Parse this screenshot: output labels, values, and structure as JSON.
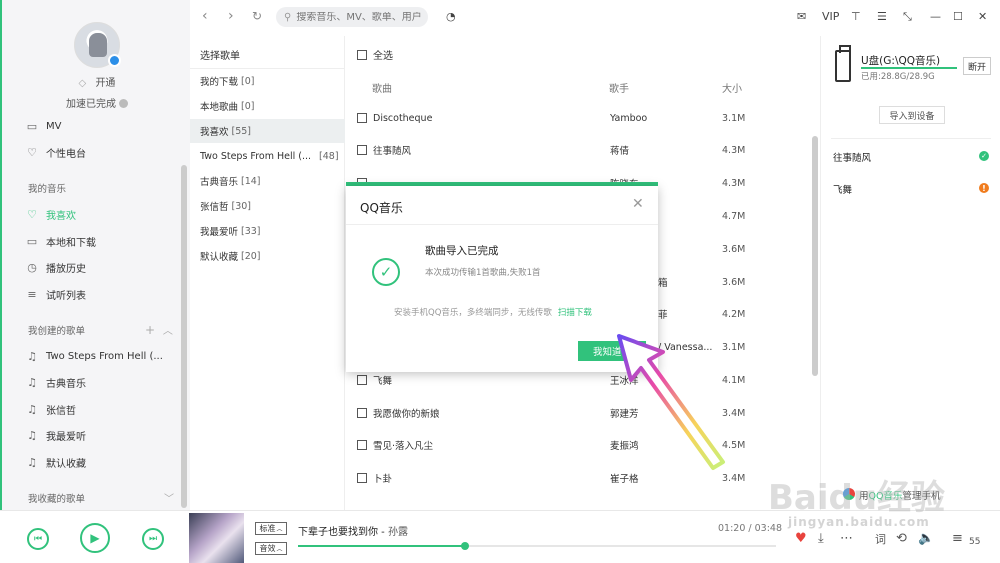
{
  "user": {
    "open_label": "开通",
    "accel_label": "加速已完成"
  },
  "sidebar": {
    "top_items": [
      {
        "label": "MV",
        "icon": "tv-icon"
      },
      {
        "label": "个性电台",
        "icon": "radio-heart-icon"
      }
    ],
    "my_music_title": "我的音乐",
    "my_music": [
      {
        "label": "我喜欢",
        "icon": "heart-icon",
        "active": true
      },
      {
        "label": "本地和下载",
        "icon": "monitor-icon"
      },
      {
        "label": "播放历史",
        "icon": "clock-icon"
      },
      {
        "label": "试听列表",
        "icon": "list-icon"
      }
    ],
    "created_title": "我创建的歌单",
    "created": [
      {
        "label": "Two Steps From Hell (..."
      },
      {
        "label": "古典音乐"
      },
      {
        "label": "张信哲"
      },
      {
        "label": "我最爱听"
      },
      {
        "label": "默认收藏"
      }
    ],
    "collected_title": "我收藏的歌单"
  },
  "topbar": {
    "search_placeholder": "搜索音乐、MV、歌单、用户",
    "vip_label": "VIP"
  },
  "playlists": {
    "title": "选择歌单",
    "items": [
      {
        "name": "我的下载",
        "count": "[0]"
      },
      {
        "name": "本地歌曲",
        "count": "[0]"
      },
      {
        "name": "我喜欢",
        "count": "[55]",
        "selected": true
      },
      {
        "name": "Two Steps From Hell (...",
        "count": "[48]"
      },
      {
        "name": "古典音乐",
        "count": "[14]"
      },
      {
        "name": "张信哲",
        "count": "[30]"
      },
      {
        "name": "我最爱听",
        "count": "[33]"
      },
      {
        "name": "默认收藏",
        "count": "[20]"
      }
    ]
  },
  "songs": {
    "select_all": "全选",
    "col_song": "歌曲",
    "col_artist": "歌手",
    "col_size": "大小",
    "rows": [
      {
        "name": "Discotheque",
        "artist": "Yamboo",
        "size": "3.1M"
      },
      {
        "name": "往事随风",
        "artist": "蒋倩",
        "size": "4.3M"
      },
      {
        "name": "",
        "artist": "",
        "size": "4.3M"
      },
      {
        "name": "",
        "artist": "",
        "size": "4.7M"
      },
      {
        "name": "",
        "artist": "",
        "size": "3.6M"
      },
      {
        "name": "",
        "artist": "",
        "size": "3.6M"
      },
      {
        "name": "",
        "artist": "",
        "size": "4.2M"
      },
      {
        "name": "",
        "artist": "",
        "size": "3.1M"
      },
      {
        "name": "飞舞",
        "artist": "王冰洋",
        "size": "4.1M"
      },
      {
        "name": "我愿做你的新娘",
        "artist": "郭建芳",
        "size": "3.4M"
      },
      {
        "name": "雪见·落入凡尘",
        "artist": "麦振鸿",
        "size": "4.5M"
      },
      {
        "name": "卜卦",
        "artist": "崔子格",
        "size": "3.4M"
      }
    ],
    "partial_artists": [
      "陈晓东",
      "箱",
      "菲",
      "/ Vanessa..."
    ]
  },
  "device": {
    "name": "U盘(G:\\QQ音乐)",
    "used": "已用:28.8G/28.9G",
    "used_fraction": 0.997,
    "disconnect_label": "断开",
    "import_label": "导入到设备",
    "songs": [
      {
        "name": "往事随风",
        "status": "ok"
      },
      {
        "name": "飞舞",
        "status": "warning"
      }
    ],
    "bottom_pre": "用",
    "bottom_link": "QQ音乐",
    "bottom_post": "管理手机"
  },
  "dialog": {
    "title": "QQ音乐",
    "headline": "歌曲导入已完成",
    "sub": "本次成功传输1首歌曲,失败1首",
    "promo": "安装手机QQ音乐，多终端同步，无线传歌",
    "promo_link": "扫描下载",
    "ok_label": "我知道了"
  },
  "player": {
    "quality_label": "标准",
    "effect_label": "音效",
    "track_title": "下辈子也要找到你",
    "track_sep": " - ",
    "track_artist": "孙露",
    "time": "01:20 / 03:48",
    "progress": 0.35,
    "lyric_label": "词",
    "queue_count": "55"
  },
  "watermark": {
    "text": "Baidu经验",
    "url": "jingyan.baidu.com"
  },
  "colors": {
    "accent": "#31c27c",
    "warning": "#f07c1e"
  }
}
